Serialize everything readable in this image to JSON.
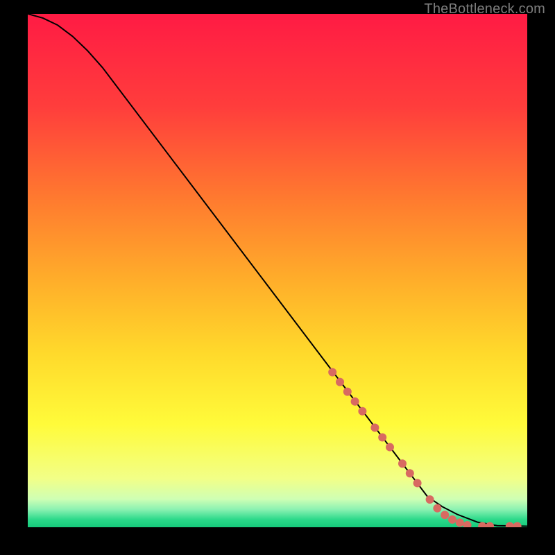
{
  "attribution": "TheBottleneck.com",
  "chart_data": {
    "type": "line",
    "title": "",
    "xlabel": "",
    "ylabel": "",
    "xlim": [
      0,
      100
    ],
    "ylim": [
      0,
      100
    ],
    "grid": false,
    "legend": false,
    "background_gradient": {
      "stops": [
        {
          "offset": 0.0,
          "color": "#ff1b44"
        },
        {
          "offset": 0.18,
          "color": "#ff3d3c"
        },
        {
          "offset": 0.36,
          "color": "#ff7a2f"
        },
        {
          "offset": 0.52,
          "color": "#ffae2a"
        },
        {
          "offset": 0.66,
          "color": "#ffd92b"
        },
        {
          "offset": 0.8,
          "color": "#fffb3a"
        },
        {
          "offset": 0.905,
          "color": "#f2ff87"
        },
        {
          "offset": 0.945,
          "color": "#cfffb4"
        },
        {
          "offset": 0.965,
          "color": "#8cf2b2"
        },
        {
          "offset": 0.985,
          "color": "#2bd98a"
        },
        {
          "offset": 1.0,
          "color": "#16c97b"
        }
      ]
    },
    "series": [
      {
        "name": "curve",
        "color": "#000000",
        "stroke_width": 2,
        "x": [
          0,
          3,
          6,
          9,
          12,
          15,
          80,
          83,
          86,
          90,
          94,
          100
        ],
        "y": [
          100,
          99.2,
          97.8,
          95.6,
          92.8,
          89.5,
          6.0,
          4.0,
          2.5,
          1.0,
          0.3,
          0.2
        ]
      }
    ],
    "markers": {
      "name": "highlight-points",
      "color": "#d86a61",
      "radius": 6,
      "x": [
        61,
        62.5,
        64,
        65.5,
        67,
        69.5,
        71,
        72.5,
        75,
        76.5,
        78,
        80.5,
        82,
        83.5,
        85,
        86.5,
        88,
        91,
        92.5,
        96.5,
        98
      ],
      "y": [
        30.2,
        28.3,
        26.4,
        24.5,
        22.6,
        19.4,
        17.5,
        15.6,
        12.4,
        10.5,
        8.6,
        5.4,
        3.7,
        2.4,
        1.5,
        0.9,
        0.4,
        0.2,
        0.2,
        0.2,
        0.2
      ]
    }
  }
}
